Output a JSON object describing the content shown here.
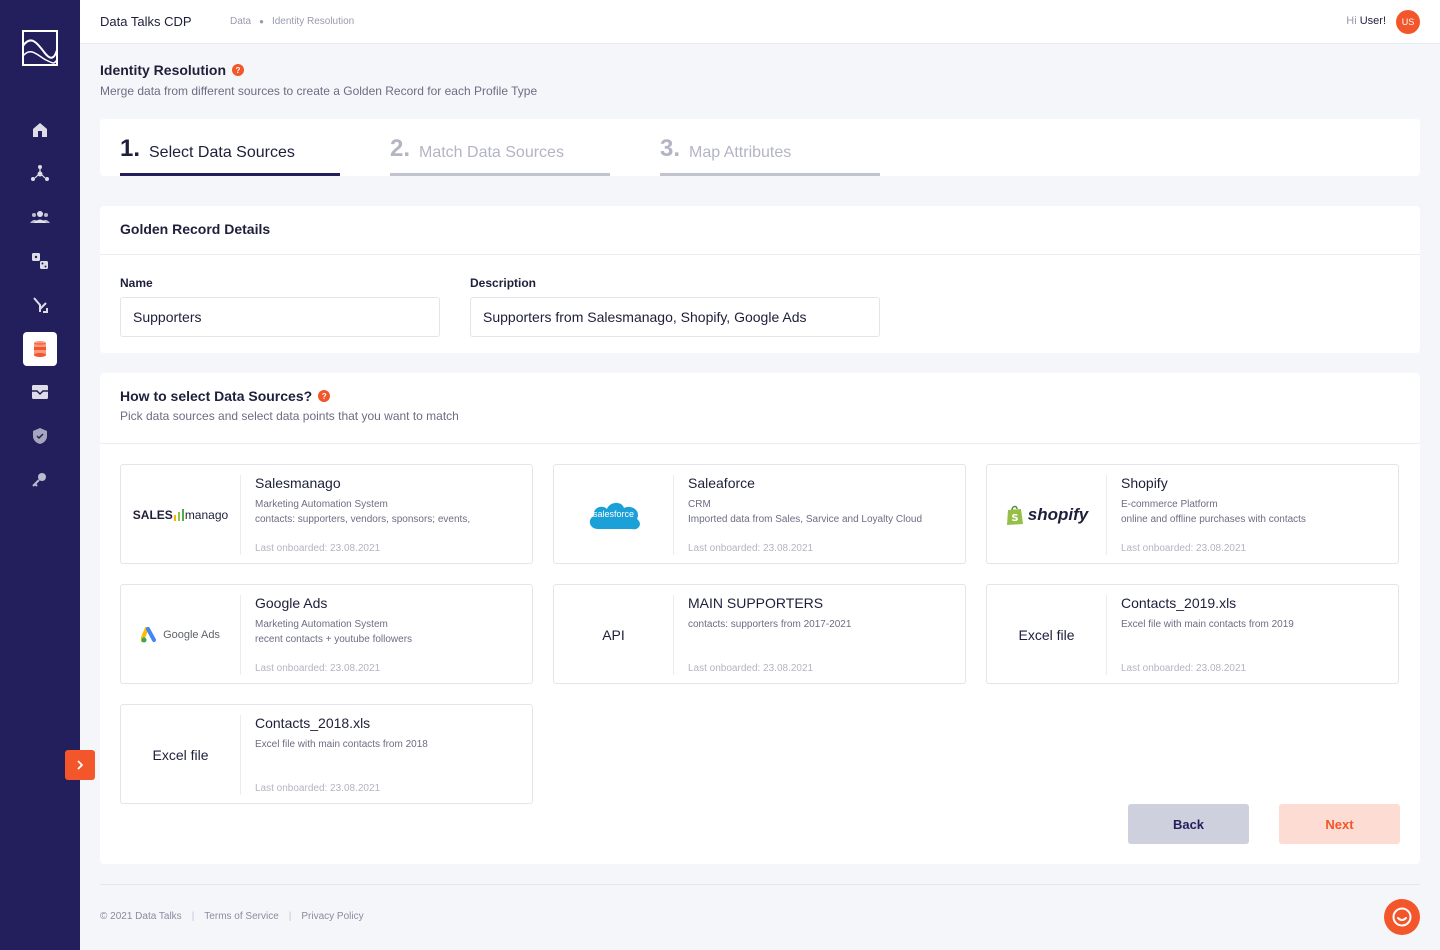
{
  "header": {
    "app_title": "Data Talks CDP",
    "breadcrumb": [
      "Data",
      "Identity Resolution"
    ],
    "greeting_prefix": "Hi",
    "greeting_user": "User!",
    "avatar_initials": "US"
  },
  "sidebar": {
    "items": [
      {
        "icon": "home-icon"
      },
      {
        "icon": "network-icon"
      },
      {
        "icon": "users-icon"
      },
      {
        "icon": "dice-icon"
      },
      {
        "icon": "merge-icon"
      },
      {
        "icon": "database-icon",
        "active": true
      },
      {
        "icon": "inbox-icon"
      },
      {
        "icon": "shield-icon"
      },
      {
        "icon": "key-icon"
      }
    ],
    "expand_icon": "chevron-right-icon"
  },
  "page": {
    "title": "Identity Resolution",
    "help": "?",
    "subtitle": "Merge data from different sources to create a Golden Record for each Profile Type"
  },
  "steps": [
    {
      "num": "1.",
      "label": "Select Data Sources",
      "active": true
    },
    {
      "num": "2.",
      "label": "Match Data Sources",
      "active": false
    },
    {
      "num": "3.",
      "label": "Map Attributes",
      "active": false
    }
  ],
  "golden_record": {
    "title": "Golden Record Details",
    "name_label": "Name",
    "name_value": "Supporters",
    "description_label": "Description",
    "description_value": "Supporters from Salesmanago, Shopify, Google Ads"
  },
  "sources": {
    "title": "How to select Data Sources?",
    "help": "?",
    "subtitle": "Pick data sources and select data points that you want to match",
    "items": [
      {
        "logo_text": "SALES",
        "logo_text2": "manago",
        "name": "Salesmanago",
        "lines": [
          "Marketing Automation System",
          "contacts: supporters, vendors, sponsors; events,"
        ],
        "meta": "Last onboarded: 23.08.2021"
      },
      {
        "logo_text": "salesforce",
        "name": "Saleaforce",
        "lines": [
          "CRM",
          "Imported data from Sales, Sarvice and Loyalty Cloud"
        ],
        "meta": "Last onboarded: 23.08.2021"
      },
      {
        "logo_text": "shopify",
        "name": "Shopify",
        "lines": [
          "E-commerce Platform",
          "online and offline purchases with contacts"
        ],
        "meta": "Last onboarded: 23.08.2021"
      },
      {
        "logo_text": "Google Ads",
        "name": "Google Ads",
        "lines": [
          "Marketing Automation System",
          "recent contacts + youtube followers"
        ],
        "meta": "Last onboarded: 23.08.2021"
      },
      {
        "logo_text": "API",
        "name": "MAIN SUPPORTERS",
        "lines": [
          "contacts: supporters from 2017-2021"
        ],
        "meta": "Last onboarded: 23.08.2021"
      },
      {
        "logo_text": "Excel file",
        "name": "Contacts_2019.xls",
        "lines": [
          "Excel file with main contacts from 2019"
        ],
        "meta": "Last onboarded: 23.08.2021"
      },
      {
        "logo_text": "Excel file",
        "name": "Contacts_2018.xls",
        "lines": [
          "Excel file with main contacts from 2018"
        ],
        "meta": "Last onboarded: 23.08.2021"
      }
    ]
  },
  "actions": {
    "back": "Back",
    "next": "Next"
  },
  "footer": {
    "copyright": "© 2021 Data Talks",
    "terms": "Terms of Service",
    "privacy": "Privacy Policy"
  },
  "colors": {
    "sidebar": "#221f5c",
    "accent": "#f2562a",
    "background": "#f5f6fa"
  }
}
